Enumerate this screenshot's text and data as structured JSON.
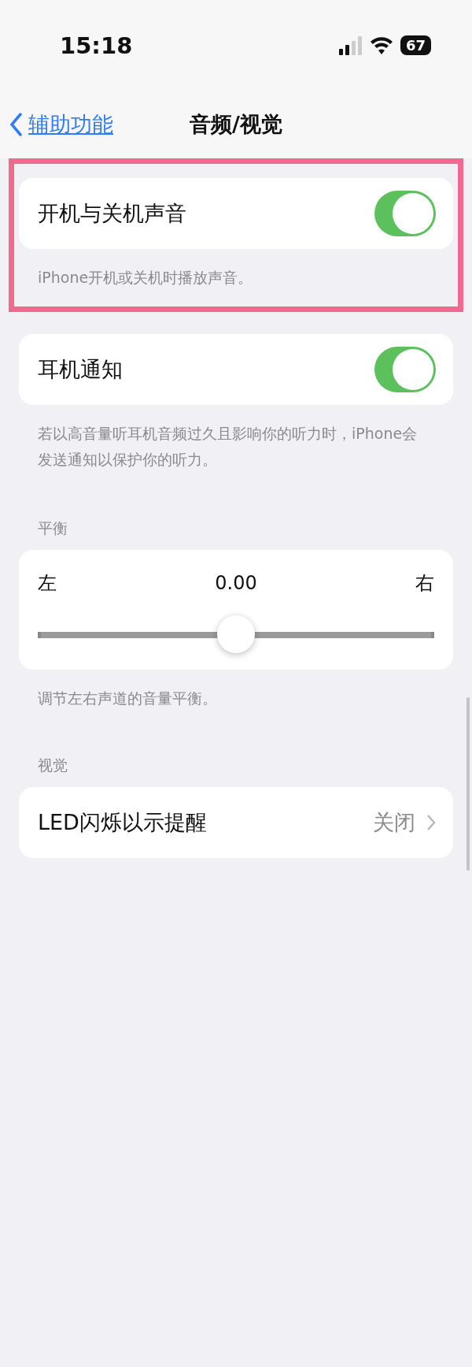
{
  "status_bar": {
    "time": "15:18",
    "battery": "67"
  },
  "nav": {
    "back": "辅助功能",
    "title": "音频/视觉"
  },
  "sections": [
    {
      "kind": "toggle",
      "highlighted": true,
      "label": "开机与关机声音",
      "on": true,
      "footer": "iPhone开机或关机时播放声音。"
    },
    {
      "kind": "toggle",
      "highlighted": false,
      "label": "耳机通知",
      "on": true,
      "footer": "若以高音量听耳机音频过久且影响你的听力时，iPhone会发送通知以保护你的听力。"
    },
    {
      "kind": "slider",
      "header": "平衡",
      "left": "左",
      "right": "右",
      "reading": "0.00",
      "level": 0.5,
      "footer": "调节左右声道的音量平衡。"
    },
    {
      "kind": "link",
      "header": "视觉",
      "label": "LED闪烁以示提醒",
      "value": "关闭"
    }
  ]
}
